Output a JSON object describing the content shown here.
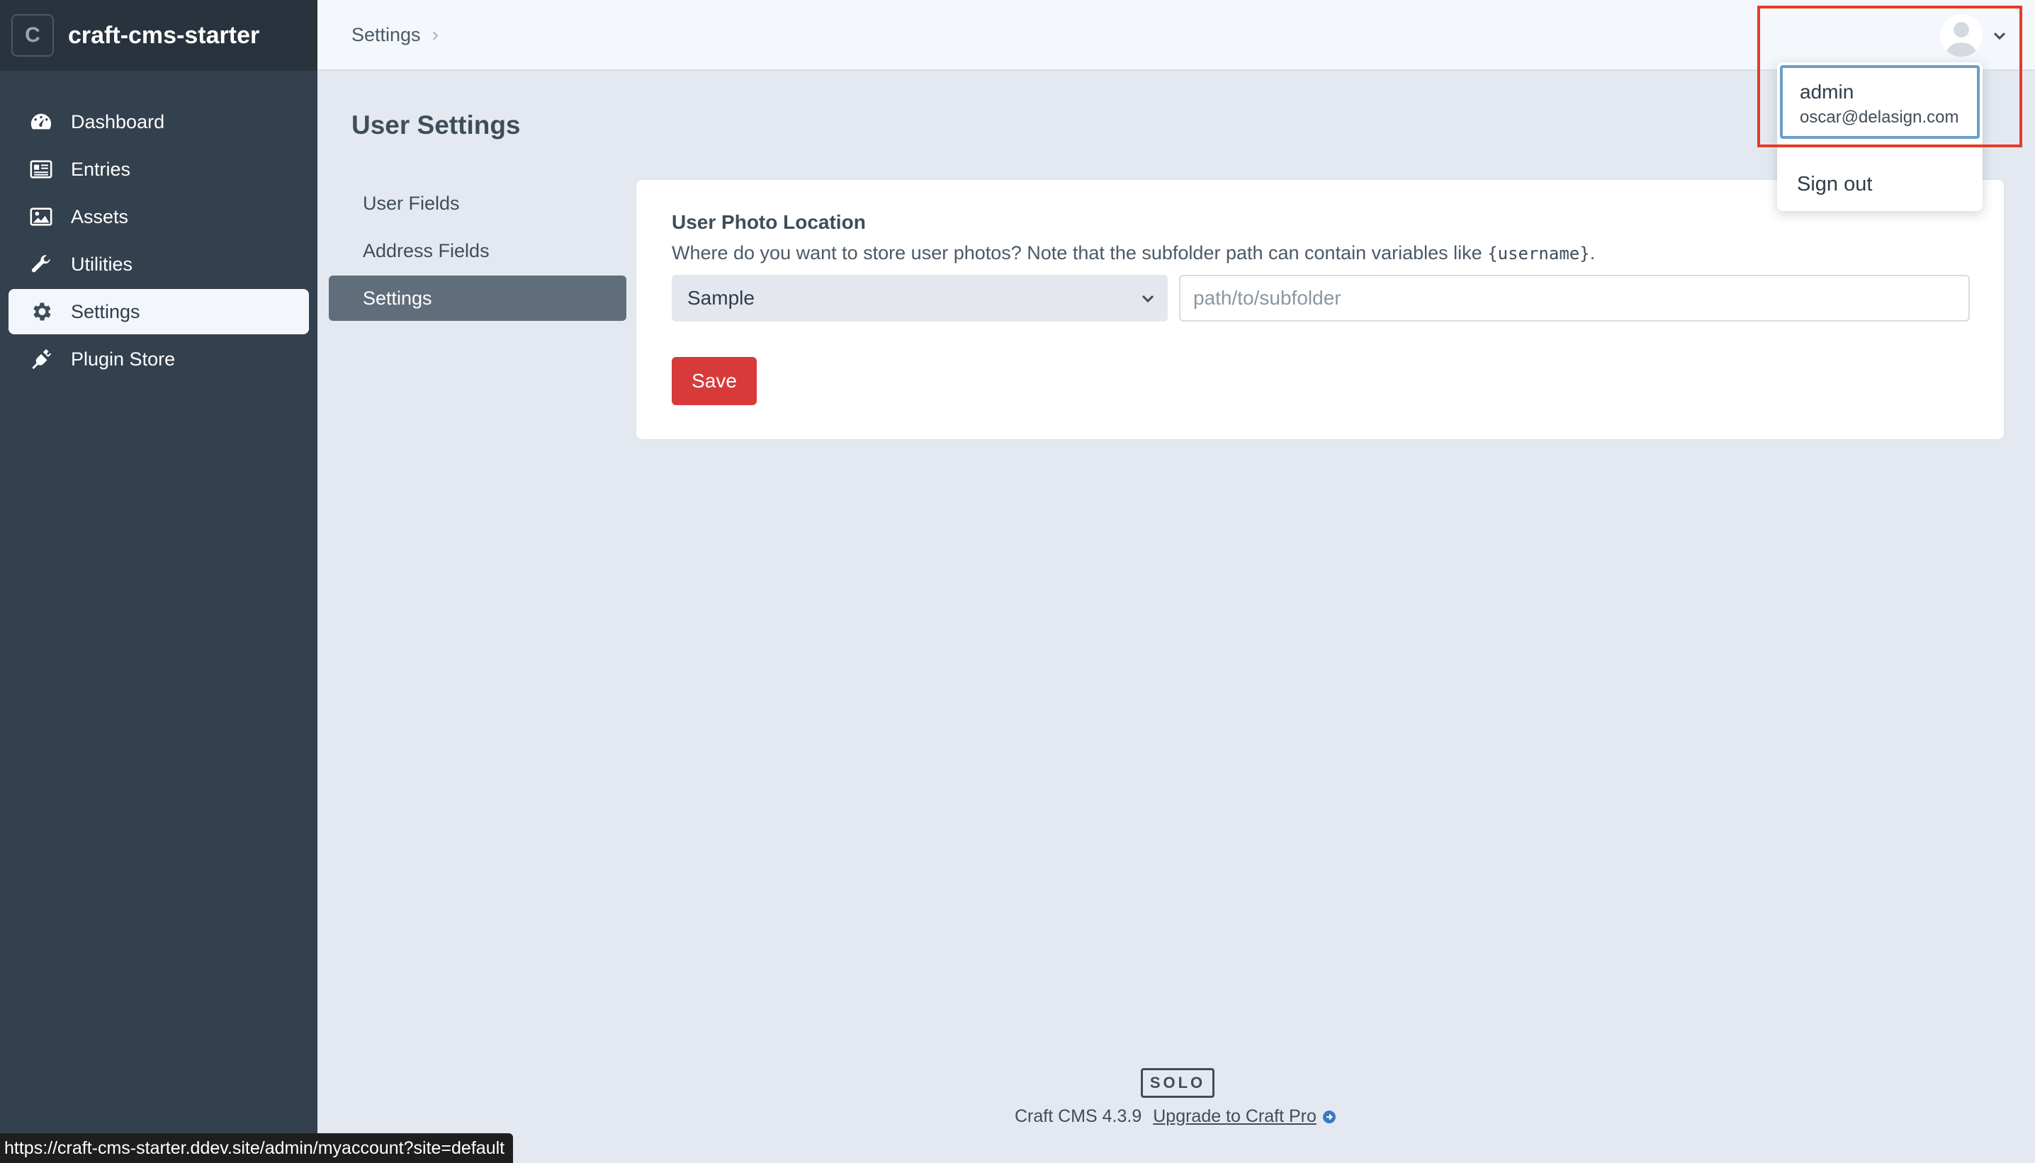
{
  "brand": {
    "logo_letter": "C",
    "name": "craft-cms-starter"
  },
  "sidebar": {
    "items": [
      {
        "label": "Dashboard",
        "icon": "gauge-icon"
      },
      {
        "label": "Entries",
        "icon": "newspaper-icon"
      },
      {
        "label": "Assets",
        "icon": "image-icon"
      },
      {
        "label": "Utilities",
        "icon": "wrench-icon"
      },
      {
        "label": "Settings",
        "icon": "gear-icon",
        "active": true
      },
      {
        "label": "Plugin Store",
        "icon": "plug-icon"
      }
    ]
  },
  "header": {
    "breadcrumb": "Settings",
    "breadcrumb_sep": "›"
  },
  "page": {
    "title": "User Settings",
    "subnav": [
      {
        "label": "User Fields"
      },
      {
        "label": "Address Fields"
      },
      {
        "label": "Settings",
        "active": true
      }
    ]
  },
  "form": {
    "label": "User Photo Location",
    "instructions_prefix": "Where do you want to store user photos? Note that the subfolder path can contain variables like ",
    "instructions_code": "{username}",
    "instructions_suffix": ".",
    "volume_selected": "Sample",
    "subfolder_value": "",
    "subfolder_placeholder": "path/to/subfolder",
    "save_label": "Save"
  },
  "user_menu": {
    "username": "admin",
    "email": "oscar@delasign.com",
    "sign_out_label": "Sign out"
  },
  "footer": {
    "edition": "SOLO",
    "version": "Craft CMS 4.3.9",
    "upgrade_label": "Upgrade to Craft Pro"
  },
  "status_url": "https://craft-cms-starter.ddev.site/admin/myaccount?site=default",
  "colors": {
    "sidebar_bg": "#33404d",
    "accent_red": "#d83a3a",
    "highlight_red": "#e53c2a",
    "focus_blue": "#6c9dc9"
  }
}
